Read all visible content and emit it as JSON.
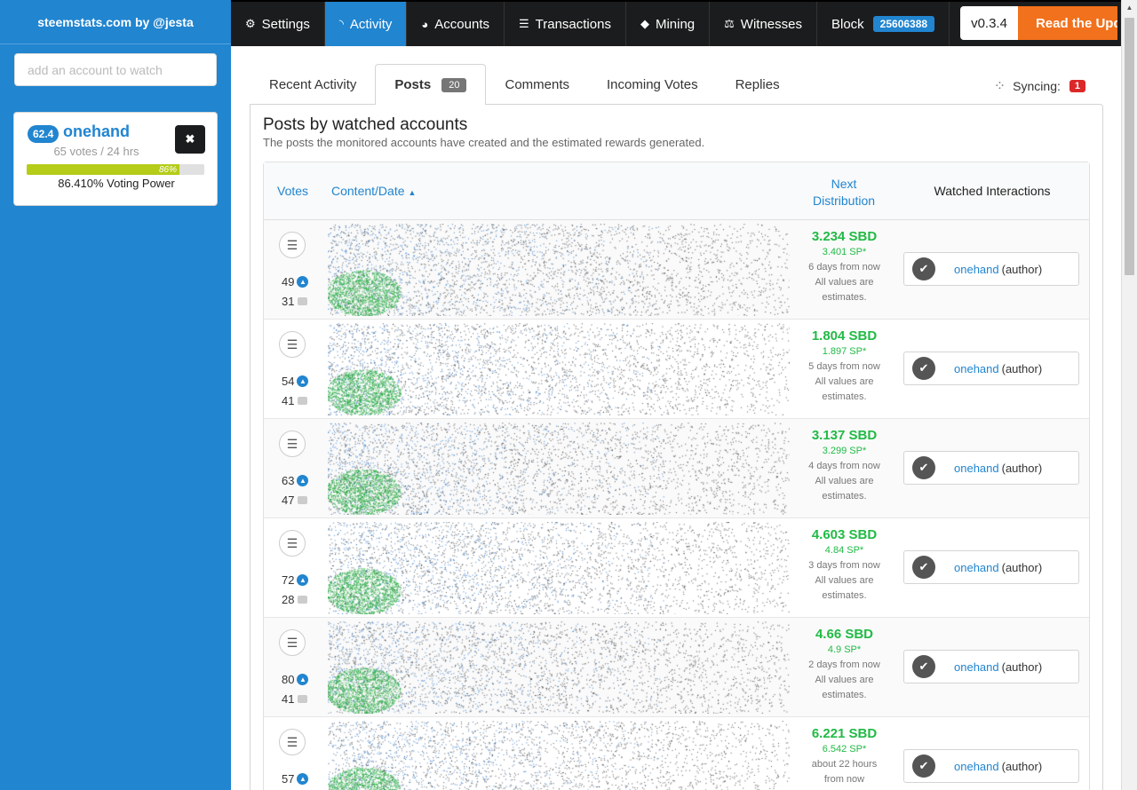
{
  "sidebar": {
    "brand": "steemstats.com by @jesta",
    "watch_placeholder": "add an account to watch",
    "account": {
      "reputation": "62.4",
      "name": "onehand",
      "votes_summary": "65 votes / 24 hrs",
      "vp_bar_label": "86%",
      "vp_fraction": 0.86,
      "voting_power": "86.410% Voting Power",
      "remove_icon": "close-icon"
    }
  },
  "nav": {
    "items": [
      {
        "label": "Settings",
        "icon": "gears-icon"
      },
      {
        "label": "Activity",
        "icon": "feed-icon"
      },
      {
        "label": "Accounts",
        "icon": "pie-chart-icon"
      },
      {
        "label": "Transactions",
        "icon": "list-icon"
      },
      {
        "label": "Mining",
        "icon": "cube-icon"
      },
      {
        "label": "Witnesses",
        "icon": "balance-scale-icon"
      }
    ],
    "block_label": "Block",
    "block_number": "25606388",
    "version": "v0.3.4",
    "update_label": "Read the Update"
  },
  "tabs": [
    {
      "label": "Recent Activity"
    },
    {
      "label": "Posts",
      "count": "20"
    },
    {
      "label": "Comments"
    },
    {
      "label": "Incoming Votes"
    },
    {
      "label": "Replies"
    }
  ],
  "sync": {
    "label": "Syncing:",
    "count": "1"
  },
  "section": {
    "title": "Posts by watched accounts",
    "subtitle": "The posts the monitored accounts have created and the estimated rewards generated."
  },
  "table": {
    "headers": {
      "votes": "Votes",
      "content": "Content/Date",
      "dist_line1": "Next",
      "dist_line2": "Distribution",
      "watched": "Watched Interactions"
    },
    "rows": [
      {
        "votes": "49",
        "comments": "31",
        "sbd": "3.234 SBD",
        "sp": "3.401 SP*",
        "when": "6 days from now",
        "note1": "All values are",
        "note2": "estimates.",
        "author": "onehand",
        "role": "(author)"
      },
      {
        "votes": "54",
        "comments": "41",
        "sbd": "1.804 SBD",
        "sp": "1.897 SP*",
        "when": "5 days from now",
        "note1": "All values are",
        "note2": "estimates.",
        "author": "onehand",
        "role": "(author)"
      },
      {
        "votes": "63",
        "comments": "47",
        "sbd": "3.137 SBD",
        "sp": "3.299 SP*",
        "when": "4 days from now",
        "note1": "All values are",
        "note2": "estimates.",
        "author": "onehand",
        "role": "(author)"
      },
      {
        "votes": "72",
        "comments": "28",
        "sbd": "4.603 SBD",
        "sp": "4.84 SP*",
        "when": "3 days from now",
        "note1": "All values are",
        "note2": "estimates.",
        "author": "onehand",
        "role": "(author)"
      },
      {
        "votes": "80",
        "comments": "41",
        "sbd": "4.66 SBD",
        "sp": "4.9 SP*",
        "when": "2 days from now",
        "note1": "All values are",
        "note2": "estimates.",
        "author": "onehand",
        "role": "(author)"
      },
      {
        "votes": "57",
        "comments": "",
        "sbd": "6.221 SBD",
        "sp": "6.542 SP*",
        "when": "about 22 hours",
        "note1": "from now",
        "note2": "",
        "author": "onehand",
        "role": "(author)"
      }
    ]
  },
  "colors": {
    "primary": "#2185d0",
    "success": "#21ba45",
    "dark": "#1b1c1d",
    "orange": "#f2711c",
    "red": "#db2828"
  }
}
